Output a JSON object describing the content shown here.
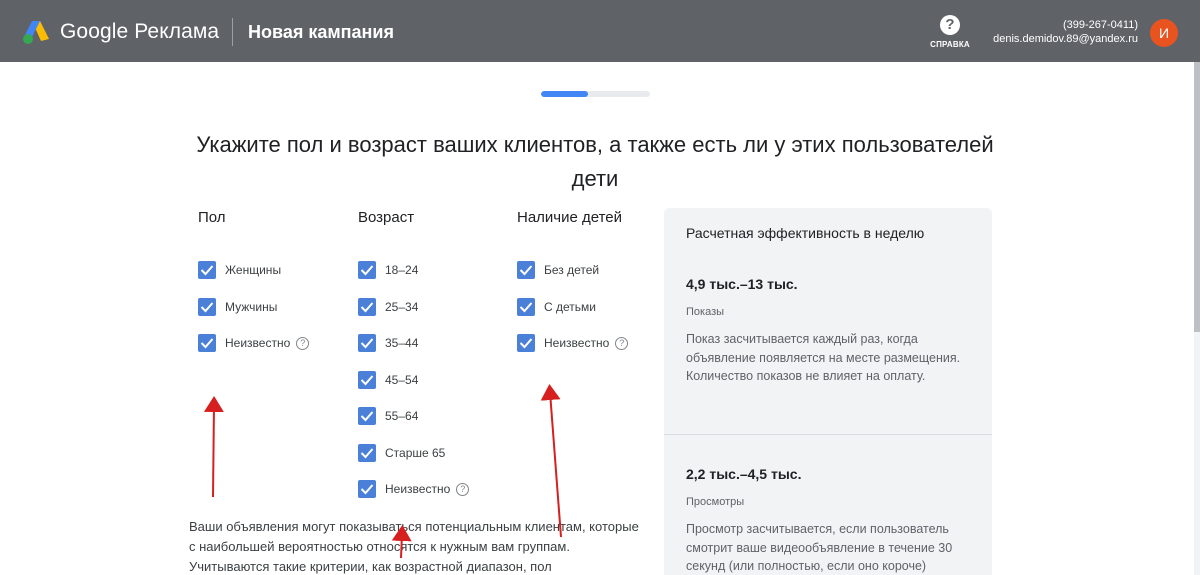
{
  "header": {
    "brand": "Google Реклама",
    "campaign_title": "Новая кампания",
    "help_label": "СПРАВКА",
    "account_phone": "(399-267-0411)",
    "account_email": "denis.demidov.89@yandex.ru",
    "avatar_letter": "И",
    "avatar_color": "#e8531f"
  },
  "progress": {
    "percent": 43
  },
  "title": "Укажите пол и возраст ваших клиентов, а также есть ли у этих пользователей дети",
  "gender": {
    "heading": "Пол",
    "options": [
      {
        "label": "Женщины",
        "checked": true
      },
      {
        "label": "Мужчины",
        "checked": true
      },
      {
        "label": "Неизвестно",
        "checked": true,
        "help_icon": "question-circle-icon"
      }
    ]
  },
  "age": {
    "heading": "Возраст",
    "options": [
      {
        "label": "18–24",
        "checked": true
      },
      {
        "label": "25–34",
        "checked": true
      },
      {
        "label": "35–44",
        "checked": true
      },
      {
        "label": "45–54",
        "checked": true
      },
      {
        "label": "55–64",
        "checked": true
      },
      {
        "label": "Старше 65",
        "checked": true
      },
      {
        "label": "Неизвестно",
        "checked": true,
        "help_icon": "question-circle-icon"
      }
    ]
  },
  "kids": {
    "heading": "Наличие детей",
    "options": [
      {
        "label": "Без детей",
        "checked": true
      },
      {
        "label": "С детьми",
        "checked": true
      },
      {
        "label": "Неизвестно",
        "checked": true,
        "help_icon": "question-circle-icon"
      }
    ]
  },
  "description": "Ваши объявления могут показываться потенциальным клиентам, которые с наибольшей вероятностью относятся к нужным вам группам. Учитываются такие критерии, как возрастной диапазон, пол",
  "estimate": {
    "title": "Расчетная эффективность в неделю",
    "metrics": [
      {
        "value": "4,9 тыс.–13 тыс.",
        "label": "Показы",
        "desc": "Показ засчитывается каждый раз, когда объявление появляется на месте размещения. Количество показов не влияет на оплату."
      },
      {
        "value": "2,2 тыс.–4,5 тыс.",
        "label": "Просмотры",
        "desc": "Просмотр засчитывается, если пользователь смотрит ваше видеообъявление в течение 30 секунд (или полностью, если оно короче)"
      }
    ]
  },
  "colors": {
    "header_bg": "#5f6368",
    "checkbox": "#4a80d8",
    "progress": "#4285f4",
    "arrow": "#d61f1f"
  }
}
